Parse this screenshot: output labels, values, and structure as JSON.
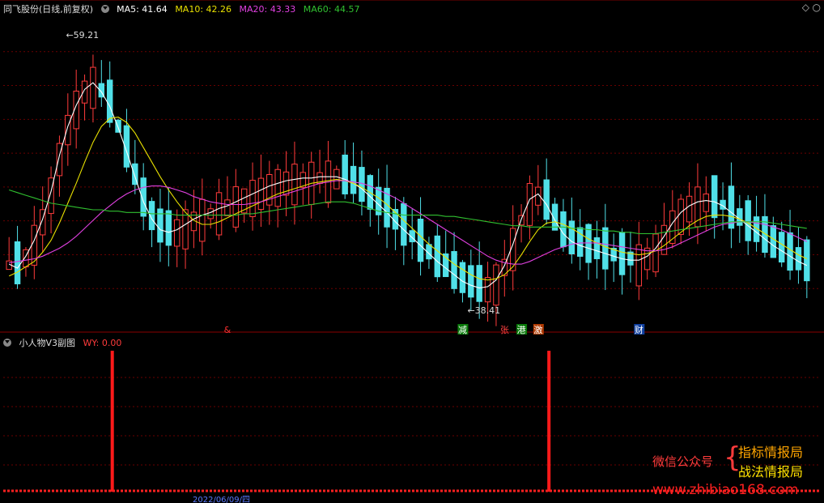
{
  "header": {
    "stock": "同飞股份(日线,前复权)",
    "ma5": "MA5: 41.64",
    "ma10": "MA10: 42.26",
    "ma20": "MA20: 43.33",
    "ma60": "MA60: 44.57"
  },
  "sub_header": {
    "title": "小人物V3副图",
    "value": "WY: 0.00"
  },
  "annotations": {
    "high": "59.21",
    "low": "38.41",
    "marks": [
      {
        "label": "&",
        "color": "#ff3030"
      },
      {
        "label": "减",
        "color": "#ffffff",
        "bg": "#0a7a0a"
      },
      {
        "label": "张",
        "color": "#ff4040"
      },
      {
        "label": "港",
        "color": "#ffffff",
        "bg": "#0a7a0a"
      },
      {
        "label": "激",
        "color": "#ffffff",
        "bg": "#b03a00"
      },
      {
        "label": "财",
        "color": "#ffffff",
        "bg": "#1040a0"
      }
    ]
  },
  "axis": {
    "date_label": "2022/06/09/四"
  },
  "watermark": {
    "left": "微信公众号",
    "right1": "指标情报局",
    "right2": "战法情报局",
    "url": "www.zhibiao168.com"
  },
  "colors": {
    "up": "#ff3b3b",
    "down": "#50e0e8",
    "ma5": "#ffffff",
    "ma10": "#e8e000",
    "ma20": "#e040e0",
    "ma60": "#30c030"
  },
  "chart_data": [
    {
      "type": "candlestick",
      "series": [
        {
          "name": "MA5",
          "values": [
            41.9,
            41.6,
            42.5,
            43.7,
            45.3,
            47.4,
            50.1,
            52.3,
            53.9,
            55.1,
            55.6,
            54.9,
            53.8,
            52.2,
            50.4,
            48.5,
            46.6,
            45.3,
            44.5,
            44.3,
            44.5,
            44.9,
            45.3,
            45.6,
            45.8,
            46.1,
            46.3,
            46.6,
            46.9,
            47.2,
            47.5,
            47.8,
            48.0,
            48.2,
            48.3,
            48.4,
            48.4,
            48.5,
            48.5,
            48.5,
            48.3,
            48.0,
            47.6,
            47.0,
            46.4,
            45.8,
            45.1,
            44.5,
            43.9,
            43.3,
            42.7,
            42.1,
            41.6,
            41.1,
            40.6,
            40.3,
            40.1,
            40.2,
            40.7,
            41.8,
            43.4,
            45.3,
            46.8,
            47.2,
            46.4,
            45.2,
            44.2,
            43.6,
            43.3,
            43.1,
            42.9,
            42.7,
            42.5,
            42.3,
            42.2,
            42.2,
            42.5,
            43.1,
            44.0,
            45.0,
            45.8,
            46.3,
            46.6,
            46.7,
            46.6,
            46.3,
            45.8,
            45.3,
            44.8,
            44.3,
            43.8,
            43.3,
            42.9,
            42.5,
            42.1,
            41.8
          ]
        },
        {
          "name": "MA10",
          "values": [
            41.0,
            41.3,
            41.7,
            42.1,
            42.8,
            43.7,
            45.0,
            46.5,
            48.0,
            49.6,
            51.1,
            52.3,
            52.9,
            53.0,
            52.6,
            51.8,
            50.7,
            49.6,
            48.5,
            47.5,
            46.6,
            45.8,
            45.2,
            44.9,
            44.9,
            45.1,
            45.4,
            45.7,
            46.0,
            46.3,
            46.6,
            46.9,
            47.2,
            47.4,
            47.6,
            47.8,
            48.0,
            48.1,
            48.2,
            48.3,
            48.2,
            48.0,
            47.7,
            47.3,
            46.9,
            46.4,
            45.8,
            45.2,
            44.6,
            44.0,
            43.4,
            42.9,
            42.4,
            41.9,
            41.5,
            41.1,
            40.8,
            40.7,
            40.8,
            41.1,
            41.7,
            42.6,
            43.6,
            44.5,
            45.0,
            45.1,
            44.9,
            44.6,
            44.2,
            43.8,
            43.5,
            43.2,
            43.0,
            42.8,
            42.7,
            42.6,
            42.7,
            42.9,
            43.3,
            43.8,
            44.3,
            44.8,
            45.2,
            45.5,
            45.6,
            45.6,
            45.5,
            45.3,
            45.0,
            44.6,
            44.2,
            43.8,
            43.4,
            43.0,
            42.6,
            42.3
          ]
        },
        {
          "name": "MA20",
          "values": [
            42.0,
            42.1,
            42.2,
            42.3,
            42.5,
            42.8,
            43.1,
            43.5,
            44.0,
            44.6,
            45.2,
            45.8,
            46.3,
            46.8,
            47.2,
            47.5,
            47.7,
            47.8,
            47.8,
            47.7,
            47.5,
            47.3,
            47.0,
            46.8,
            46.6,
            46.5,
            46.4,
            46.4,
            46.4,
            46.5,
            46.6,
            46.8,
            47.0,
            47.2,
            47.4,
            47.6,
            47.8,
            48.0,
            48.1,
            48.2,
            48.2,
            48.1,
            48.0,
            47.8,
            47.5,
            47.2,
            46.9,
            46.5,
            46.1,
            45.7,
            45.3,
            44.9,
            44.5,
            44.1,
            43.7,
            43.3,
            42.9,
            42.5,
            42.2,
            42.0,
            41.9,
            41.9,
            42.1,
            42.4,
            42.7,
            43.0,
            43.2,
            43.4,
            43.5,
            43.5,
            43.5,
            43.4,
            43.3,
            43.2,
            43.1,
            43.0,
            42.9,
            42.9,
            43.0,
            43.2,
            43.5,
            43.8,
            44.1,
            44.4,
            44.7,
            44.9,
            45.0,
            45.1,
            45.1,
            45.0,
            44.9,
            44.7,
            44.5,
            44.2,
            43.9,
            43.6
          ]
        },
        {
          "name": "MA60",
          "values": [
            47.5,
            47.3,
            47.1,
            46.9,
            46.7,
            46.5,
            46.4,
            46.3,
            46.2,
            46.1,
            46.0,
            46.0,
            45.9,
            45.9,
            45.8,
            45.8,
            45.8,
            45.7,
            45.7,
            45.7,
            45.6,
            45.6,
            45.6,
            45.6,
            45.6,
            45.6,
            45.6,
            45.6,
            45.7,
            45.7,
            45.8,
            45.9,
            46.0,
            46.1,
            46.2,
            46.3,
            46.4,
            46.5,
            46.6,
            46.6,
            46.6,
            46.5,
            46.3,
            46.1,
            45.9,
            45.8,
            45.7,
            45.6,
            45.6,
            45.6,
            45.6,
            45.6,
            45.5,
            45.5,
            45.4,
            45.3,
            45.2,
            45.1,
            45.0,
            44.9,
            44.8,
            44.8,
            44.7,
            44.7,
            44.7,
            44.7,
            44.7,
            44.6,
            44.6,
            44.5,
            44.5,
            44.4,
            44.4,
            44.3,
            44.3,
            44.2,
            44.2,
            44.2,
            44.3,
            44.4,
            44.5,
            44.6,
            44.7,
            44.8,
            44.9,
            45.0,
            45.1,
            45.1,
            45.1,
            45.1,
            45.1,
            45.0,
            44.9,
            44.8,
            44.7,
            44.6
          ]
        }
      ],
      "price_range": [
        37.5,
        60.5
      ],
      "high_marker": 59.21,
      "low_marker": 38.41
    },
    {
      "type": "bar",
      "title": "小人物V3副图",
      "series": [
        {
          "name": "WY",
          "spikes_at_index": [
            12,
            64
          ]
        }
      ],
      "values_at_spikes": [
        1,
        1
      ]
    }
  ]
}
